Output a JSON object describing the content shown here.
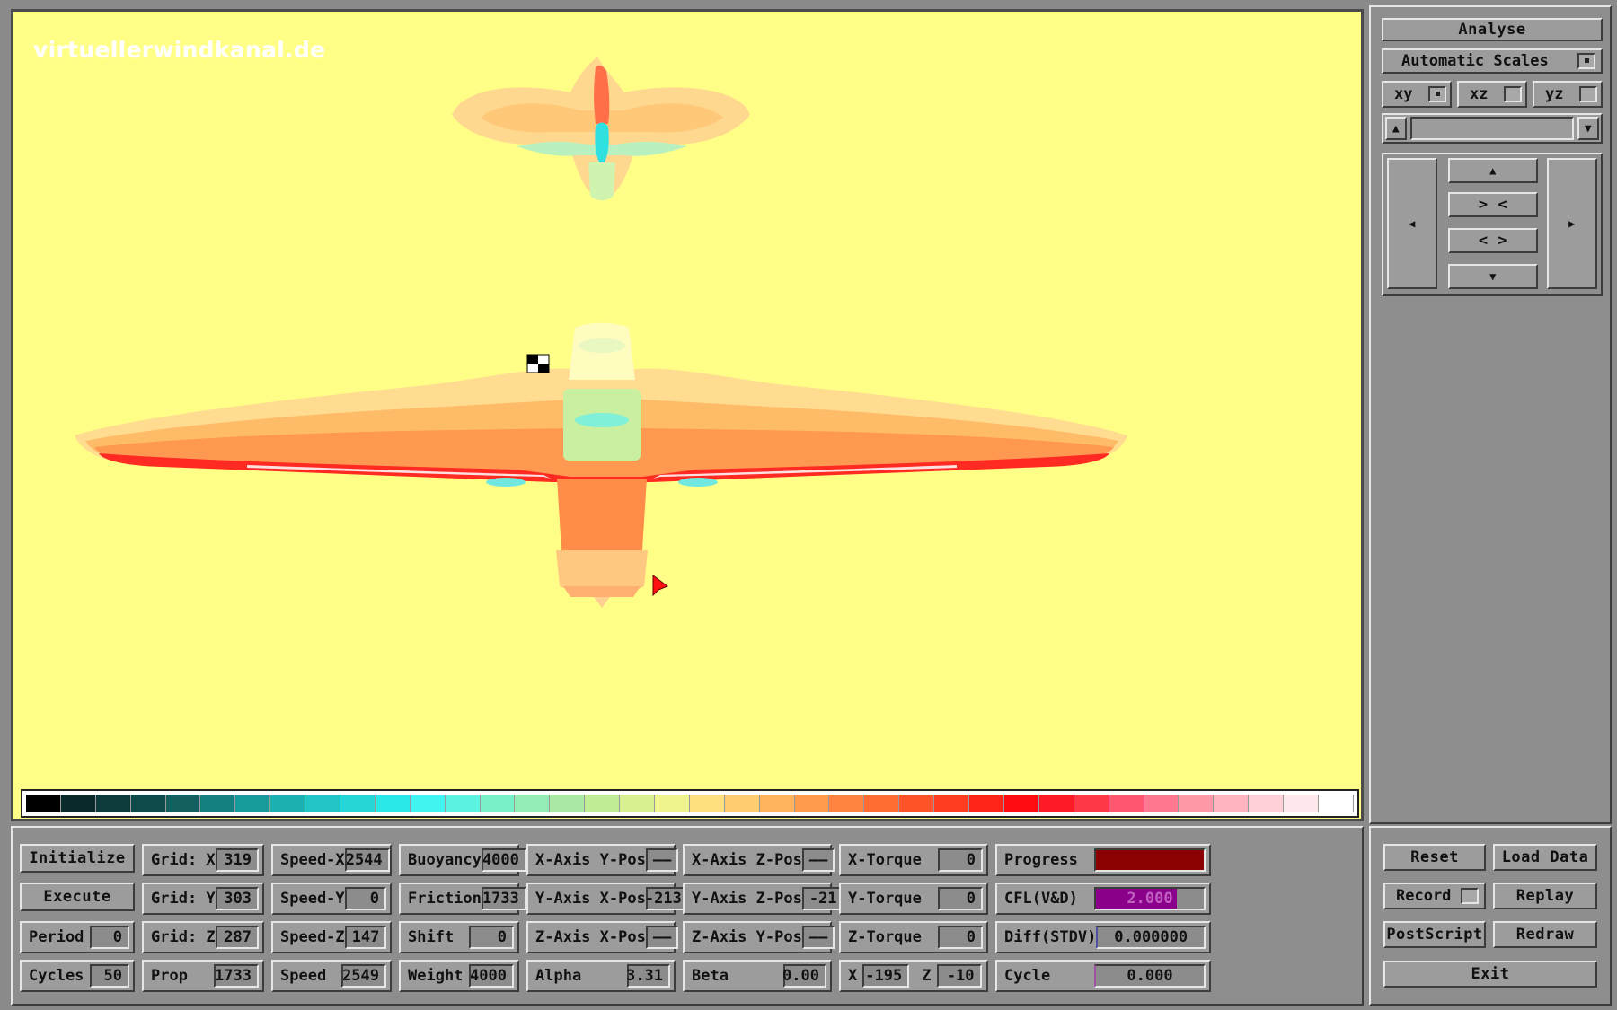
{
  "viewport": {
    "watermark": "virtuellerwindkanal.de",
    "background": "#ffff88",
    "colorbar": [
      "#000000",
      "#0a2a2a",
      "#0d3b3b",
      "#0f4a4a",
      "#126060",
      "#148080",
      "#179a9a",
      "#1cb0b0",
      "#22c4c4",
      "#26d6d6",
      "#2ae8e8",
      "#40f4f0",
      "#5cf4e0",
      "#78f0c8",
      "#92ecb4",
      "#aaeaa4",
      "#c0ec96",
      "#d8f090",
      "#f0f48c",
      "#ffe080",
      "#ffcc70",
      "#ffb45c",
      "#ff9c4c",
      "#ff8440",
      "#ff6c34",
      "#ff5428",
      "#ff3c20",
      "#ff2418",
      "#ff0c10",
      "#ff1a28",
      "#ff3848",
      "#ff5870",
      "#ff7890",
      "#ff98a8",
      "#ffb4c0",
      "#ffd0d8",
      "#ffe8ec",
      "#ffffff"
    ],
    "plot_colors": {
      "orange_light": "#ffd080",
      "orange": "#ffb060",
      "orange_dark": "#ff8c48",
      "red": "#ff2020",
      "cyan": "#40e8e8",
      "green_light": "#c8f0a0"
    }
  },
  "side": {
    "analyse_label": "Analyse",
    "auto_scales_label": "Automatic Scales",
    "auto_scales_checked": true,
    "planes": [
      {
        "label": "xy",
        "checked": true
      },
      {
        "label": "xz",
        "checked": false
      },
      {
        "label": "yz",
        "checked": false
      }
    ],
    "nav": {
      "up": "▲",
      "down": "▼",
      "left": "◀",
      "right": "▶",
      "zoom_in": "> <",
      "zoom_out": "< >"
    },
    "scroll_up": "▲",
    "scroll_down": "▼"
  },
  "bottom": {
    "col1": [
      {
        "type": "button",
        "label": "Initialize"
      },
      {
        "type": "button",
        "label": "Execute"
      },
      {
        "type": "field",
        "label": "Period",
        "value": "0"
      },
      {
        "type": "field",
        "label": "Cycles",
        "value": "50"
      }
    ],
    "col2": [
      {
        "label": "Grid: X",
        "value": "319"
      },
      {
        "label": "Grid: Y",
        "value": "303"
      },
      {
        "label": "Grid: Z",
        "value": "287"
      },
      {
        "label": "Prop",
        "value": "1733"
      }
    ],
    "col3": [
      {
        "label": "Speed-X",
        "value": "2544"
      },
      {
        "label": "Speed-Y",
        "value": "0"
      },
      {
        "label": "Speed-Z",
        "value": "147"
      },
      {
        "label": "Speed",
        "value": "2549"
      }
    ],
    "col4": [
      {
        "label": "Buoyancy",
        "value": "4000"
      },
      {
        "label": "Friction",
        "value": "1733"
      },
      {
        "label": "Shift",
        "value": "0"
      },
      {
        "label": "Weight",
        "value": "4000"
      }
    ],
    "col5": [
      {
        "label": "X-Axis Y-Pos",
        "value": "——"
      },
      {
        "label": "Y-Axis X-Pos",
        "value": "-213"
      },
      {
        "label": "Z-Axis X-Pos",
        "value": "——"
      },
      {
        "label": "Alpha",
        "value": "3.31"
      }
    ],
    "col6": [
      {
        "label": "X-Axis Z-Pos",
        "value": "——"
      },
      {
        "label": "Y-Axis Z-Pos",
        "value": "-21"
      },
      {
        "label": "Z-Axis Y-Pos",
        "value": "——"
      },
      {
        "label": "Beta",
        "value": "0.00"
      }
    ],
    "col7": [
      {
        "label": "X-Torque",
        "value": "0"
      },
      {
        "label": "Y-Torque",
        "value": "0"
      },
      {
        "label": "Z-Torque",
        "value": "0"
      }
    ],
    "col7_last": {
      "x_label": "X",
      "x_value": "-195",
      "z_label": "Z",
      "z_value": "-10"
    },
    "col8": {
      "progress_label": "Progress",
      "progress_fraction": 1.0,
      "progress_color": "#8b0000",
      "cfl_label": "CFL(V&D)",
      "cfl_value": "2.000",
      "cfl_fraction": 0.75,
      "cfl_color": "#8b008b",
      "diff_label": "Diff(STDV)",
      "diff_value": "0.000000",
      "cycle_label": "Cycle",
      "cycle_value": "0.000"
    },
    "right_buttons": {
      "reset": "Reset",
      "load_data": "Load Data",
      "record": "Record",
      "record_checked": false,
      "replay": "Replay",
      "postscript": "PostScript",
      "redraw": "Redraw",
      "exit": "Exit"
    }
  }
}
